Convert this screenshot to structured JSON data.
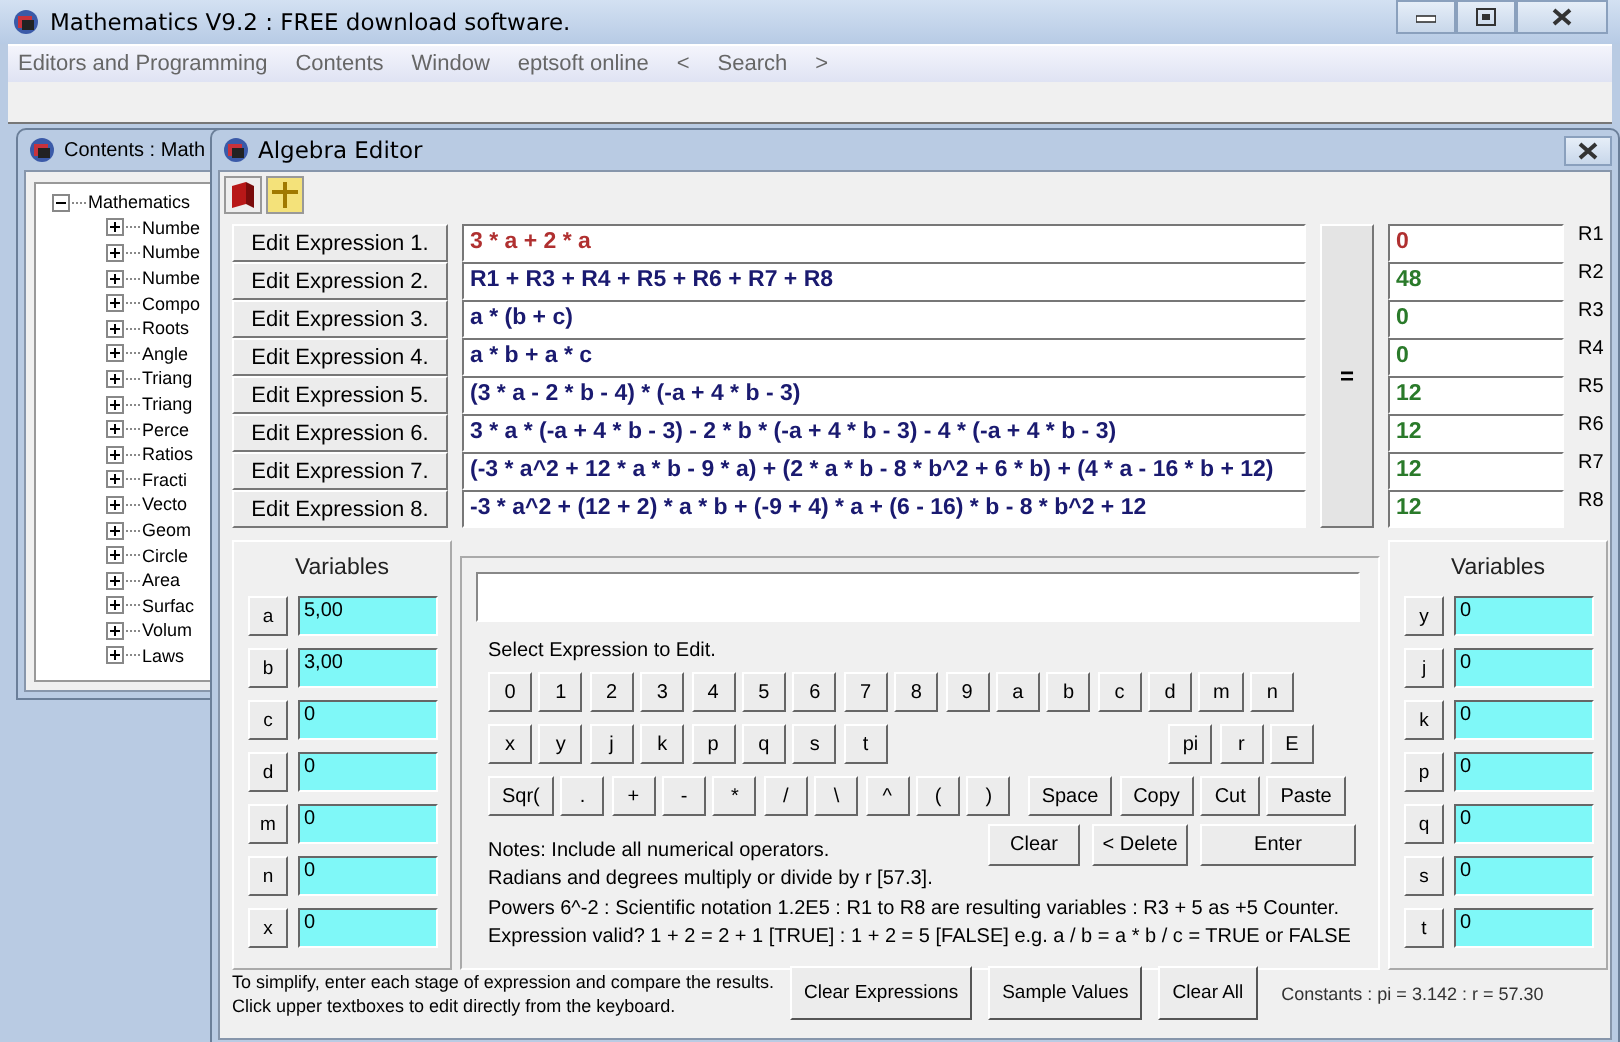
{
  "app": {
    "title": "Mathematics V9.2 : FREE download software.",
    "menu": [
      "Editors and Programming",
      "Contents",
      "Window",
      "eptsoft online",
      "<",
      "Search",
      ">"
    ]
  },
  "contents_window": {
    "title": "Contents : Math",
    "tree": [
      {
        "label": "Mathematics",
        "expanded": true,
        "children": [
          {
            "label": "Numbe",
            "expanded": false
          },
          {
            "label": "Numbe",
            "expanded": false
          },
          {
            "label": "Numbe",
            "expanded": false
          },
          {
            "label": "Compo",
            "expanded": false
          },
          {
            "label": "Roots",
            "expanded": false
          },
          {
            "label": "Angle",
            "expanded": false
          },
          {
            "label": "Triang",
            "expanded": false
          },
          {
            "label": "Triang",
            "expanded": false
          },
          {
            "label": "Perce",
            "expanded": false
          },
          {
            "label": "Ratios",
            "expanded": false
          },
          {
            "label": "Fracti",
            "expanded": false
          },
          {
            "label": "Vecto",
            "expanded": false
          },
          {
            "label": "Geom",
            "expanded": false
          },
          {
            "label": "Circle",
            "expanded": false
          },
          {
            "label": "Area",
            "expanded": false
          },
          {
            "label": "Surfac",
            "expanded": false
          },
          {
            "label": "Volum",
            "expanded": false
          },
          {
            "label": "Laws",
            "expanded": false
          }
        ]
      }
    ]
  },
  "algebra_editor": {
    "title": "Algebra Editor",
    "expressions": [
      {
        "button": "Edit Expression 1.",
        "expression": "3 * a + 2 * a",
        "result": "0",
        "register": "R1",
        "selected": true
      },
      {
        "button": "Edit Expression 2.",
        "expression": "R1 + R3 + R4 + R5 + R6 + R7 + R8",
        "result": "48",
        "register": "R2",
        "selected": false
      },
      {
        "button": "Edit Expression 3.",
        "expression": "a * (b + c)",
        "result": "0",
        "register": "R3",
        "selected": false
      },
      {
        "button": "Edit Expression 4.",
        "expression": "a * b + a * c",
        "result": "0",
        "register": "R4",
        "selected": false
      },
      {
        "button": "Edit Expression 5.",
        "expression": "(3 * a - 2 * b - 4) * (-a + 4 * b - 3)",
        "result": "12",
        "register": "R5",
        "selected": false
      },
      {
        "button": "Edit Expression 6.",
        "expression": "3 * a * (-a + 4 * b - 3) - 2 * b * (-a + 4 * b - 3) - 4 * (-a + 4 * b - 3)",
        "result": "12",
        "register": "R6",
        "selected": false
      },
      {
        "button": "Edit Expression 7.",
        "expression": "(-3 * a^2 + 12 * a * b - 9 * a) + (2 * a * b - 8 * b^2 + 6 * b) + (4 * a - 16 * b + 12)",
        "result": "12",
        "register": "R7",
        "selected": false
      },
      {
        "button": "Edit Expression 8.",
        "expression": "-3 * a^2 + (12 + 2) * a * b + (-9 + 4) * a + (6 - 16) * b - 8 * b^2 + 12",
        "result": "12",
        "register": "R8",
        "selected": false
      }
    ],
    "equals": "=",
    "variables_left": {
      "title": "Variables",
      "items": [
        {
          "name": "a",
          "value": "5,00"
        },
        {
          "name": "b",
          "value": "3,00"
        },
        {
          "name": "c",
          "value": "0"
        },
        {
          "name": "d",
          "value": "0"
        },
        {
          "name": "m",
          "value": "0"
        },
        {
          "name": "n",
          "value": "0"
        },
        {
          "name": "x",
          "value": "0"
        }
      ]
    },
    "variables_right": {
      "title": "Variables",
      "items": [
        {
          "name": "y",
          "value": "0"
        },
        {
          "name": "j",
          "value": "0"
        },
        {
          "name": "k",
          "value": "0"
        },
        {
          "name": "p",
          "value": "0"
        },
        {
          "name": "q",
          "value": "0"
        },
        {
          "name": "s",
          "value": "0"
        },
        {
          "name": "t",
          "value": "0"
        }
      ]
    },
    "keypad": {
      "hint": "Select Expression to Edit.",
      "row1": [
        "0",
        "1",
        "2",
        "3",
        "4",
        "5",
        "6",
        "7",
        "8",
        "9",
        "a",
        "b",
        "c",
        "d",
        "m",
        "n"
      ],
      "row2_left": [
        "x",
        "y",
        "j",
        "k",
        "p",
        "q",
        "s",
        "t"
      ],
      "row2_right": [
        "pi",
        "r",
        "E"
      ],
      "row3": [
        "Sqr(",
        ".",
        "+",
        "-",
        "*",
        "/",
        "\\",
        "^",
        "(",
        ")",
        "Space",
        "Copy",
        "Cut",
        "Paste"
      ],
      "row4": [
        "Clear",
        "< Delete",
        "Enter"
      ]
    },
    "notes": [
      "Notes:  Include all numerical operators.",
      "Radians and degrees multiply or divide by r [57.3].",
      "Powers 6^-2 : Scientific notation 1.2E5 : R1 to R8 are resulting variables : R3 + 5 as +5 Counter.",
      "Expression valid?    1 + 2 = 2 + 1 [TRUE] : 1 + 2 = 5 [FALSE]    e.g. a / b = a * b / c = TRUE or FALSE"
    ],
    "footer_text": [
      "To simplify, enter each stage of expression and compare the results.",
      "Click upper textboxes to edit directly from the keyboard."
    ],
    "footer_buttons": [
      "Clear Expressions",
      "Sample Values",
      "Clear All"
    ],
    "constants": "Constants : pi = 3.142 : r = 57.30"
  }
}
